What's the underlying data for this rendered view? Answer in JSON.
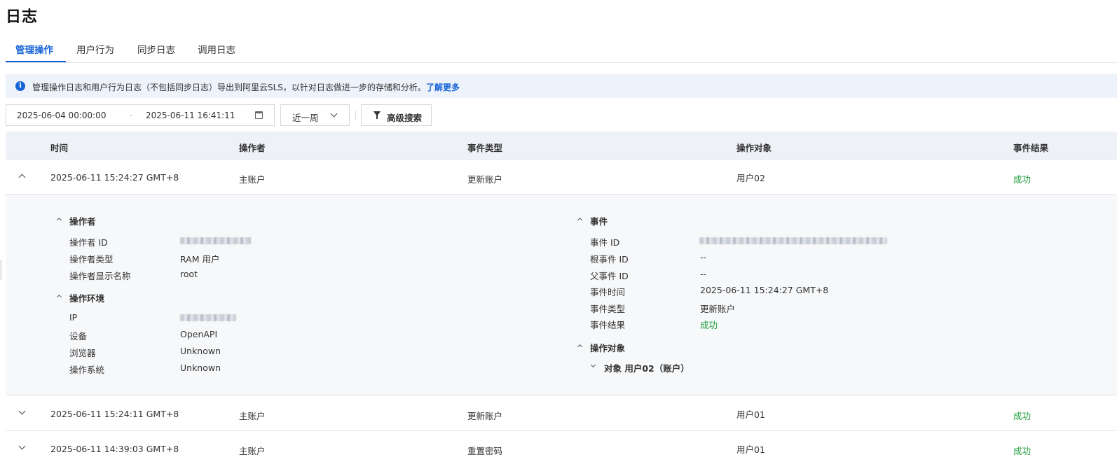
{
  "page": {
    "title": "日志"
  },
  "tabs": [
    {
      "label": "管理操作",
      "active": true
    },
    {
      "label": "用户行为",
      "active": false
    },
    {
      "label": "同步日志",
      "active": false
    },
    {
      "label": "调用日志",
      "active": false
    }
  ],
  "notice": {
    "icon": "info-icon",
    "text": "管理操作日志和用户行为日志（不包括同步日志）导出到阿里云SLS，以针对日志做进一步的存储和分析。",
    "link": "了解更多"
  },
  "filters": {
    "date_start": "2025-06-04 00:00:00",
    "date_separator": "-",
    "date_end": "2025-06-11 16:41:11",
    "period": "近一周",
    "advanced_search": "高级搜索"
  },
  "table": {
    "columns": [
      "时间",
      "操作者",
      "事件类型",
      "操作对象",
      "事件结果"
    ],
    "rows": [
      {
        "time": "2025-06-11 15:24:27 GMT+8",
        "operator": "主账户",
        "event_type": "更新账户",
        "target": "用户02",
        "result": "成功",
        "expanded": true
      },
      {
        "time": "2025-06-11 15:24:11 GMT+8",
        "operator": "主账户",
        "event_type": "更新账户",
        "target": "用户01",
        "result": "成功",
        "expanded": false
      },
      {
        "time": "2025-06-11 14:39:03 GMT+8",
        "operator": "主账户",
        "event_type": "重置密码",
        "target": "用户01",
        "result": "成功",
        "expanded": false
      }
    ]
  },
  "detail": {
    "operator_section": {
      "title": "操作者",
      "fields": [
        {
          "key": "操作者 ID",
          "value": ""
        },
        {
          "key": "操作者类型",
          "value": "RAM 用户"
        },
        {
          "key": "操作者显示名称",
          "value": "root"
        }
      ]
    },
    "env_section": {
      "title": "操作环境",
      "fields": [
        {
          "key": "IP",
          "value": ""
        },
        {
          "key": "设备",
          "value": "OpenAPI"
        },
        {
          "key": "浏览器",
          "value": "Unknown"
        },
        {
          "key": "操作系统",
          "value": "Unknown"
        }
      ]
    },
    "event_section": {
      "title": "事件",
      "fields": [
        {
          "key": "事件 ID",
          "value": ""
        },
        {
          "key": "根事件 ID",
          "value": "--"
        },
        {
          "key": "父事件 ID",
          "value": "--"
        },
        {
          "key": "事件时间",
          "value": "2025-06-11 15:24:27 GMT+8"
        },
        {
          "key": "事件类型",
          "value": "更新账户"
        },
        {
          "key": "事件结果",
          "value": "成功"
        }
      ]
    },
    "target_section": {
      "title": "操作对象",
      "item": "对象 用户02（账户）"
    }
  },
  "colors": {
    "accent": "#1764d6",
    "success": "#1e9b3a",
    "header_bg": "#eef1f5",
    "notice_bg": "#eef3fb"
  }
}
